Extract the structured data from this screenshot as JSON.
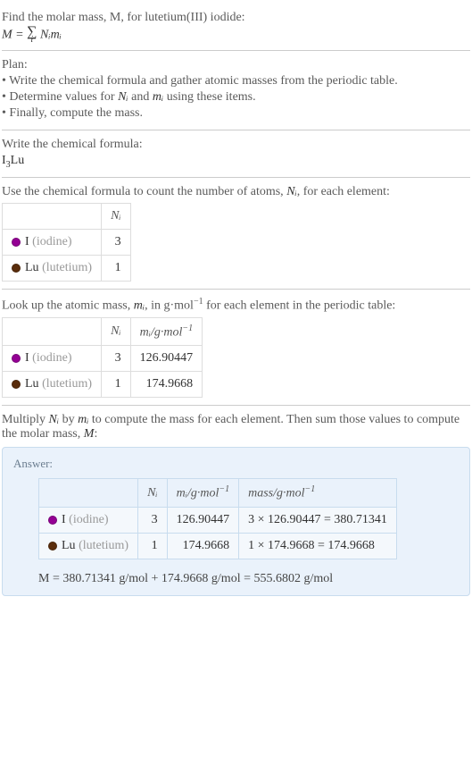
{
  "intro": {
    "line1": "Find the molar mass, M, for lutetium(III) iodide:",
    "formula_lhs": "M = ",
    "sigma_sub": "i",
    "formula_rhs": " Nᵢmᵢ"
  },
  "plan": {
    "title": "Plan:",
    "bullet1": "• Write the chemical formula and gather atomic masses from the periodic table.",
    "bullet2_pre": "• Determine values for ",
    "bullet2_Ni": "Nᵢ",
    "bullet2_mid": " and ",
    "bullet2_mi": "mᵢ",
    "bullet2_post": " using these items.",
    "bullet3": "• Finally, compute the mass."
  },
  "writeFormula": {
    "title": "Write the chemical formula:",
    "formula_pre": "I",
    "formula_sub": "3",
    "formula_post": "Lu"
  },
  "countAtoms": {
    "title_pre": "Use the chemical formula to count the number of atoms, ",
    "title_var": "Nᵢ",
    "title_post": ", for each element:",
    "header_Ni": "Nᵢ",
    "row1_symbol": "I",
    "row1_name": "(iodine)",
    "row1_Ni": "3",
    "row2_symbol": "Lu",
    "row2_name": "(lutetium)",
    "row2_Ni": "1"
  },
  "atomicMass": {
    "title_pre": "Look up the atomic mass, ",
    "title_var": "mᵢ",
    "title_mid": ", in g·mol",
    "title_exp": "−1",
    "title_post": " for each element in the periodic table:",
    "header_Ni": "Nᵢ",
    "header_mi_pre": "mᵢ/g·mol",
    "header_mi_exp": "−1",
    "row1_symbol": "I",
    "row1_name": "(iodine)",
    "row1_Ni": "3",
    "row1_mi": "126.90447",
    "row2_symbol": "Lu",
    "row2_name": "(lutetium)",
    "row2_Ni": "1",
    "row2_mi": "174.9668"
  },
  "multiply": {
    "title_pre": "Multiply ",
    "title_Ni": "Nᵢ",
    "title_by": " by ",
    "title_mi": "mᵢ",
    "title_mid": " to compute the mass for each element. Then sum those values to compute the molar mass, ",
    "title_M": "M",
    "title_post": ":"
  },
  "answer": {
    "label": "Answer:",
    "header_Ni": "Nᵢ",
    "header_mi_pre": "mᵢ/g·mol",
    "header_mi_exp": "−1",
    "header_mass_pre": "mass/g·mol",
    "header_mass_exp": "−1",
    "row1_symbol": "I",
    "row1_name": "(iodine)",
    "row1_Ni": "3",
    "row1_mi": "126.90447",
    "row1_mass": "3 × 126.90447 = 380.71341",
    "row2_symbol": "Lu",
    "row2_name": "(lutetium)",
    "row2_Ni": "1",
    "row2_mi": "174.9668",
    "row2_mass": "1 × 174.9668 = 174.9668",
    "final": "M = 380.71341 g/mol + 174.9668 g/mol = 555.6802 g/mol"
  }
}
